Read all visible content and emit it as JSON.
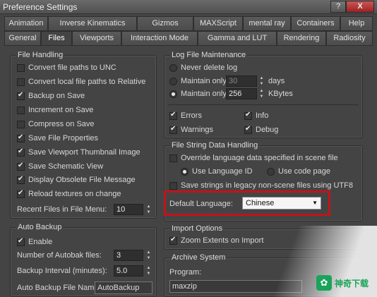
{
  "window": {
    "title": "Preference Settings",
    "help_btn": "?",
    "close_btn": "X"
  },
  "tabs_top": [
    "Animation",
    "Inverse Kinematics",
    "Gizmos",
    "MAXScript",
    "mental ray",
    "Containers",
    "Help"
  ],
  "tabs_bottom": [
    "General",
    "Files",
    "Viewports",
    "Interaction Mode",
    "Gamma and LUT",
    "Rendering",
    "Radiosity"
  ],
  "active_tab": "Files",
  "file_handling": {
    "title": "File Handling",
    "items": [
      {
        "label": "Convert file paths to UNC",
        "checked": false
      },
      {
        "label": "Convert local file paths to Relative",
        "checked": false
      },
      {
        "label": "Backup on Save",
        "checked": true
      },
      {
        "label": "Increment on Save",
        "checked": false
      },
      {
        "label": "Compress on Save",
        "checked": false
      },
      {
        "label": "Save File Properties",
        "checked": true
      },
      {
        "label": "Save Viewport Thumbnail Image",
        "checked": true
      },
      {
        "label": "Save Schematic View",
        "checked": true
      },
      {
        "label": "Display Obsolete File Message",
        "checked": true
      },
      {
        "label": "Reload textures on change",
        "checked": true
      }
    ],
    "recent_label": "Recent Files in File Menu:",
    "recent_value": "10"
  },
  "auto_backup": {
    "title": "Auto Backup",
    "enable_label": "Enable",
    "num_files_label": "Number of Autobak files:",
    "num_files_value": "3",
    "interval_label": "Backup Interval (minutes):",
    "interval_value": "5.0",
    "file_name_label": "Auto Backup File Name:",
    "file_name_value": "AutoBackup"
  },
  "log_maintenance": {
    "title": "Log File Maintenance",
    "never_delete": "Never delete log",
    "maintain_days_label": "Maintain only",
    "maintain_days_value": "30",
    "days_unit": "days",
    "maintain_kb_label": "Maintain only",
    "maintain_kb_value": "256",
    "kb_unit": "KBytes",
    "errors": "Errors",
    "info": "Info",
    "warnings": "Warnings",
    "debug": "Debug"
  },
  "file_string": {
    "title": "File String Data Handling",
    "override_label": "Override language data specified in scene file",
    "use_lang_id": "Use Language ID",
    "use_code_page": "Use code page",
    "save_legacy": "Save strings in legacy non-scene files using UTF8",
    "default_lang_label": "Default Language:",
    "default_lang_value": "Chinese"
  },
  "import_options": {
    "title": "Import Options",
    "zoom_extents": "Zoom Extents on Import"
  },
  "archive_system": {
    "title": "Archive System",
    "program_label": "Program:",
    "program_value": "maxzip"
  },
  "watermark": {
    "text": "神奇下载"
  },
  "colors": {
    "highlight_border": "#c0141a",
    "panel_bg": "#444444",
    "logo_green": "#1aa35a"
  }
}
